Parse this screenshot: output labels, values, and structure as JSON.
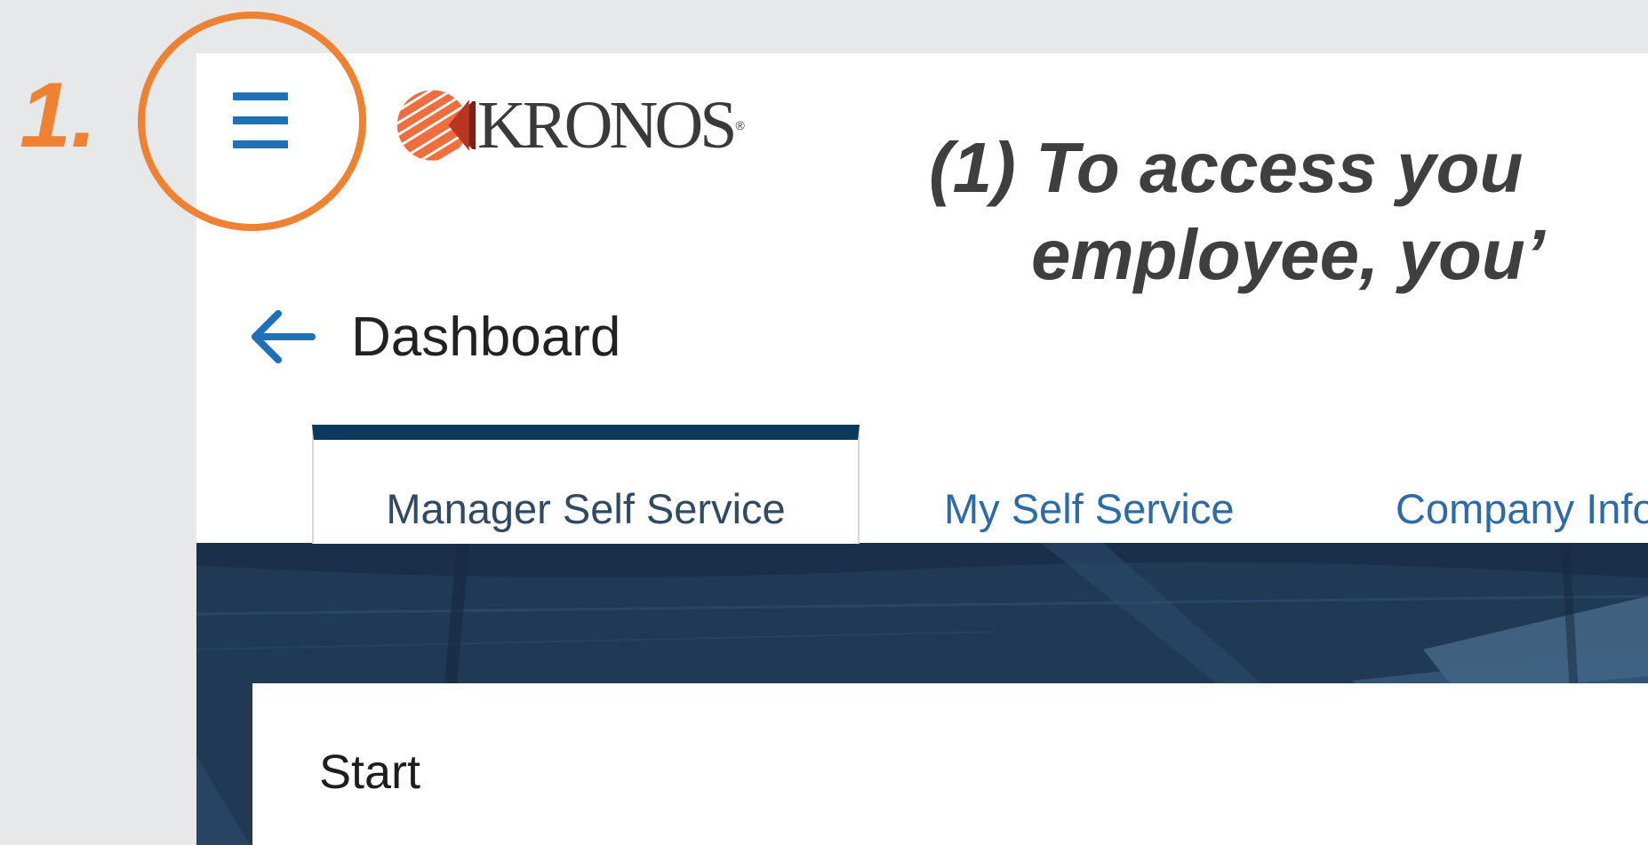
{
  "annotation": {
    "step_number": "1.",
    "instruction_line1": "(1) To access you",
    "instruction_line2": "employee, you’",
    "highlight_color": "#ef8132"
  },
  "header": {
    "menu_icon": "hamburger-menu-icon",
    "logo_icon": "kronos-logo-icon",
    "logo_text": "KRONOS",
    "logo_registered": "®",
    "accent_color": "#1f70b8"
  },
  "page": {
    "back_icon": "arrow-left-icon",
    "title": "Dashboard"
  },
  "tabs": [
    {
      "label": "Manager Self Service",
      "active": true
    },
    {
      "label": "My Self Service",
      "active": false
    },
    {
      "label": "Company Info",
      "active": false
    }
  ],
  "tab_colors": {
    "active_indicator": "#0d3a5c",
    "inactive_text": "#2d6aa8"
  },
  "card": {
    "title": "Start"
  }
}
